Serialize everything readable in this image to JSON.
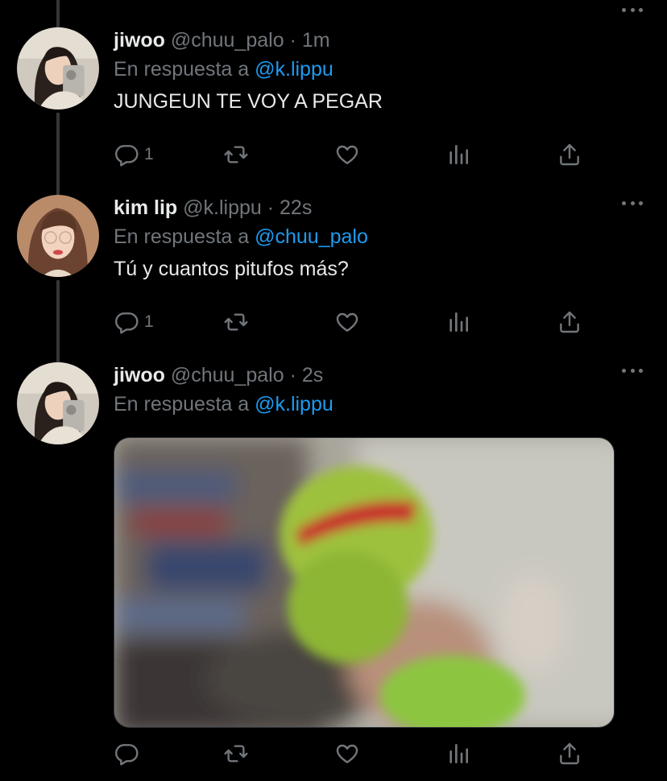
{
  "colors": {
    "background": "#000000",
    "primary_text": "#e7e9ea",
    "secondary_text": "#71767b",
    "accent": "#1d9bf0",
    "thread_line": "#333639"
  },
  "icons": {
    "reply": "reply-icon",
    "retweet": "retweet-icon",
    "like": "heart-icon",
    "views": "views-icon",
    "share": "share-icon",
    "more": "more-icon"
  },
  "tweets": [
    {
      "name": "jiwoo",
      "handle": "@chuu_palo",
      "dot": "·",
      "time": "1m",
      "reply_prefix": "En respuesta a",
      "reply_to": "@k.lippu",
      "text": "JUNGEUN TE VOY A PEGAR",
      "reply_count": "1"
    },
    {
      "name": "kim lip",
      "handle": "@k.lippu",
      "dot": "·",
      "time": "22s",
      "reply_prefix": "En respuesta a",
      "reply_to": "@chuu_palo",
      "text": "Tú y cuantos pitufos más?",
      "reply_count": "1"
    },
    {
      "name": "jiwoo",
      "handle": "@chuu_palo",
      "dot": "·",
      "time": "2s",
      "reply_prefix": "En respuesta a",
      "reply_to": "@k.lippu",
      "text": "",
      "reply_count": ""
    }
  ]
}
